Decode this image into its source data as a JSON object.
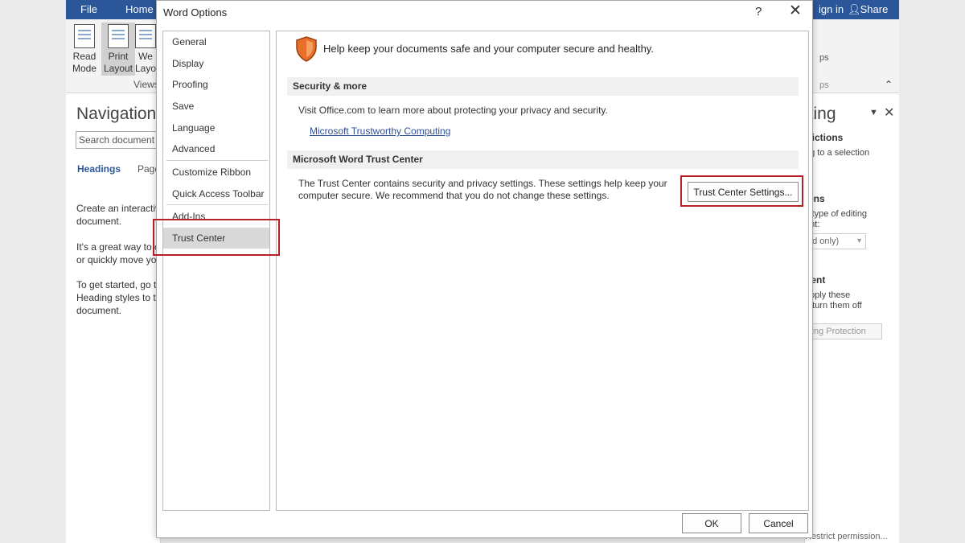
{
  "word": {
    "tabs": {
      "file": "File",
      "home": "Home",
      "sign_in": "ign in",
      "share": "Share"
    },
    "ribbon": {
      "read_mode": "Read\nMode",
      "print_layout": "Print\nLayout",
      "web_layout": "We\nLayo",
      "views_group": "Views",
      "right_group_1": "ps",
      "right_group_2": "ps"
    },
    "navigation": {
      "title": "Navigation",
      "search_placeholder": "Search document",
      "headings_tab": "Headings",
      "pages_tab": "Page",
      "p1": "Create an interactiv\ndocument.",
      "p2": "It's a great way to c\nor quickly move yo",
      "p3": "To get started, go to\nHeading styles to th\ndocument."
    },
    "restrict_pane": {
      "title": "iting",
      "sec1_heading": "trictions",
      "sec1_text": "ng to a selection",
      "sec2_heading": "ions",
      "sec2_text": "s type of editing\nent:",
      "select_value": "ad only)",
      "sec3_heading": "nent",
      "sec3_text": "apply these\nn turn them off",
      "protection_button": "cing Protection",
      "restrict_link": "Restrict permission..."
    }
  },
  "dialog": {
    "title": "Word Options",
    "help": "?",
    "close": "✕",
    "categories": [
      "General",
      "Display",
      "Proofing",
      "Save",
      "Language",
      "Advanced",
      "Customize Ribbon",
      "Quick Access Toolbar",
      "Add-Ins",
      "Trust Center"
    ],
    "selected_category": "Trust Center",
    "content": {
      "intro": "Help keep your documents safe and your computer secure and healthy.",
      "security_heading": "Security & more",
      "security_text": "Visit Office.com to learn more about protecting your privacy and security.",
      "security_link": "Microsoft Trustworthy Computing",
      "trust_heading": "Microsoft Word Trust Center",
      "trust_text": "The Trust Center contains security and privacy settings. These settings help keep your computer secure. We recommend that you do not change these settings.",
      "trust_button": "Trust Center Settings..."
    },
    "ok": "OK",
    "cancel": "Cancel"
  },
  "colors": {
    "accent": "#2b579a",
    "highlight": "#b72025",
    "shield": "#e8702a"
  }
}
